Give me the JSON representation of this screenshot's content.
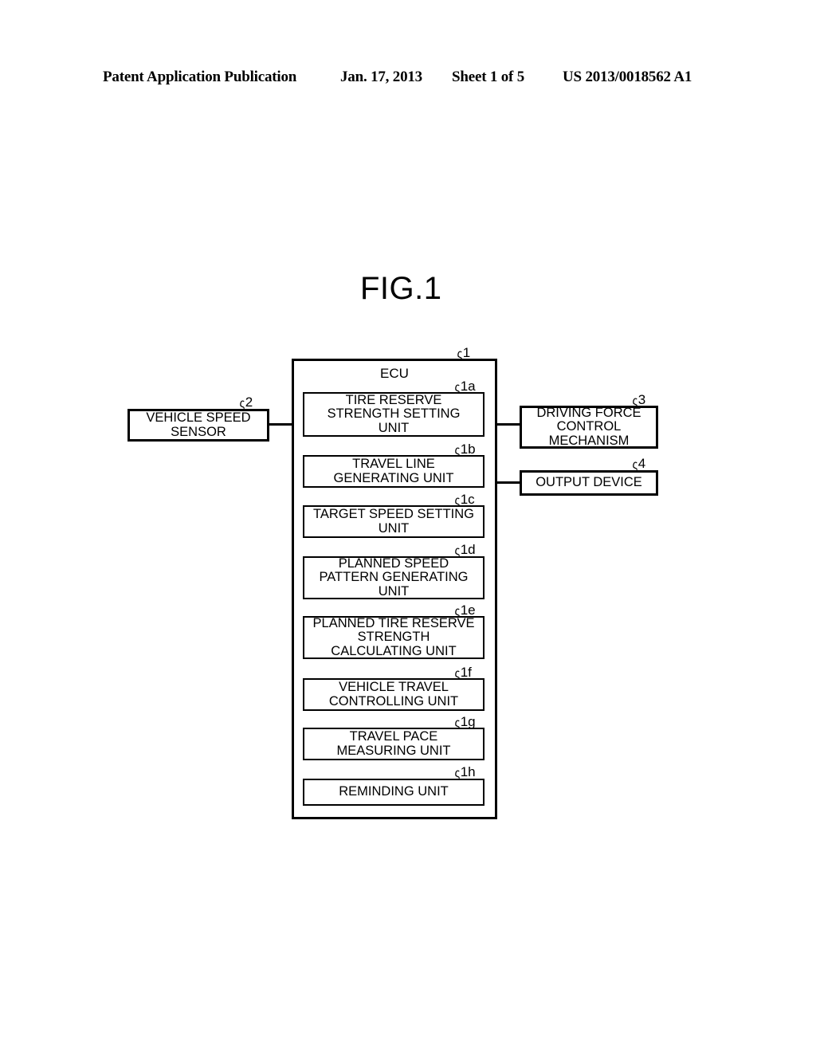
{
  "header": {
    "publication": "Patent Application Publication",
    "date": "Jan. 17, 2013",
    "sheet": "Sheet 1 of 5",
    "doc_number": "US 2013/0018562 A1"
  },
  "figure": {
    "title": "FIG.1",
    "ecu": {
      "label": "ECU",
      "ref": "1"
    },
    "units": [
      {
        "ref": "1a",
        "label": "TIRE RESERVE\nSTRENGTH SETTING\nUNIT"
      },
      {
        "ref": "1b",
        "label": "TRAVEL LINE\nGENERATING UNIT"
      },
      {
        "ref": "1c",
        "label": "TARGET SPEED SETTING\nUNIT"
      },
      {
        "ref": "1d",
        "label": "PLANNED SPEED\nPATTERN GENERATING\nUNIT"
      },
      {
        "ref": "1e",
        "label": "PLANNED TIRE RESERVE\nSTRENGTH\nCALCULATING UNIT"
      },
      {
        "ref": "1f",
        "label": "VEHICLE TRAVEL\nCONTROLLING UNIT"
      },
      {
        "ref": "1g",
        "label": "TRAVEL PACE\nMEASURING UNIT"
      },
      {
        "ref": "1h",
        "label": "REMINDING UNIT"
      }
    ],
    "external": [
      {
        "ref": "2",
        "label": "VEHICLE SPEED\nSENSOR",
        "side": "left"
      },
      {
        "ref": "3",
        "label": "DRIVING FORCE\nCONTROL\nMECHANISM",
        "side": "right"
      },
      {
        "ref": "4",
        "label": "OUTPUT DEVICE",
        "side": "right"
      }
    ],
    "ref_hook": "ς"
  }
}
